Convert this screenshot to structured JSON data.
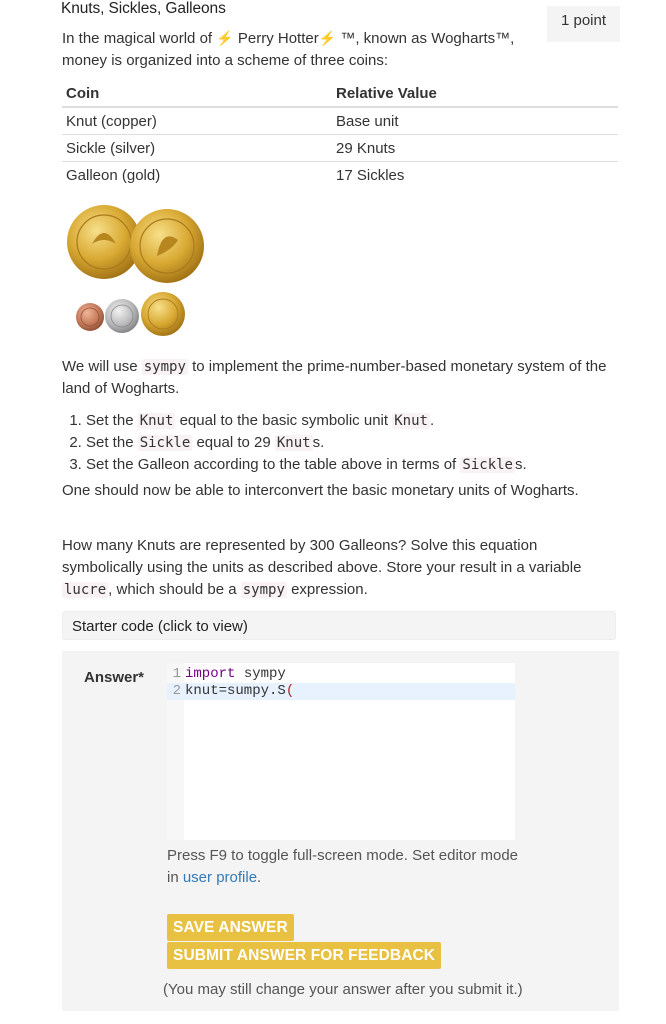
{
  "question": {
    "title": "Knuts, Sickles, Galleons",
    "points": "1 point",
    "intro": {
      "part1": "In the magical world of ",
      "bolt_icon": "⚡",
      "brand": " Perry Hotter",
      "part2": " ™, known as Wogharts™, money is organized into a scheme of three coins:"
    },
    "table": {
      "headers": [
        "Coin",
        "Relative Value"
      ],
      "rows": [
        [
          "Knut (copper)",
          "Base unit"
        ],
        [
          "Sickle (silver)",
          "29 Knuts"
        ],
        [
          "Galleon (gold)",
          "17 Sickles"
        ]
      ]
    },
    "image_alt": "coins",
    "para1": {
      "a": "We will use ",
      "code": "sympy",
      "b": " to implement the prime-number-based monetary system of the land of Wogharts."
    },
    "steps": [
      {
        "a": "Set the ",
        "code1": "Knut",
        "b": " equal to the basic symbolic unit ",
        "code2": "Knut",
        "c": "."
      },
      {
        "a": "Set the ",
        "code1": "Sickle",
        "b": " equal to 29 ",
        "code2": "Knut",
        "c": "s."
      },
      {
        "a": "Set the Galleon according to the table above in terms of ",
        "code1": "Sickle",
        "c": "s."
      }
    ],
    "para2": "One should now be able to interconvert the basic monetary units of Wogharts.",
    "para3": {
      "a": "How many Knuts are represented by 300 Galleons? Solve this equation symbolically using the units as described above. Store your result in a variable ",
      "code1": "lucre",
      "b": ", which should be a ",
      "code2": "sympy",
      "c": " expression."
    }
  },
  "starter_code": {
    "label": "Starter code (click to view)"
  },
  "answer": {
    "label": "Answer*",
    "code_lines": [
      {
        "num": "1",
        "kw": "import",
        "rest": " sympy"
      },
      {
        "num": "2",
        "text": "knut=sumpy.S",
        "err": "("
      }
    ],
    "hint_text": "Press F9 to toggle full-screen mode. Set editor mode in ",
    "hint_link": "user profile",
    "hint_end": ".",
    "save_label": "SAVE ANSWER",
    "submit_label": "SUBMIT ANSWER FOR FEEDBACK",
    "note": "(You may still change your answer after you submit it.)"
  },
  "colors": {
    "button": "#e8c143",
    "link": "#337ab7",
    "panel": "#f4f4f4",
    "active_line": "#e8f2fe"
  }
}
